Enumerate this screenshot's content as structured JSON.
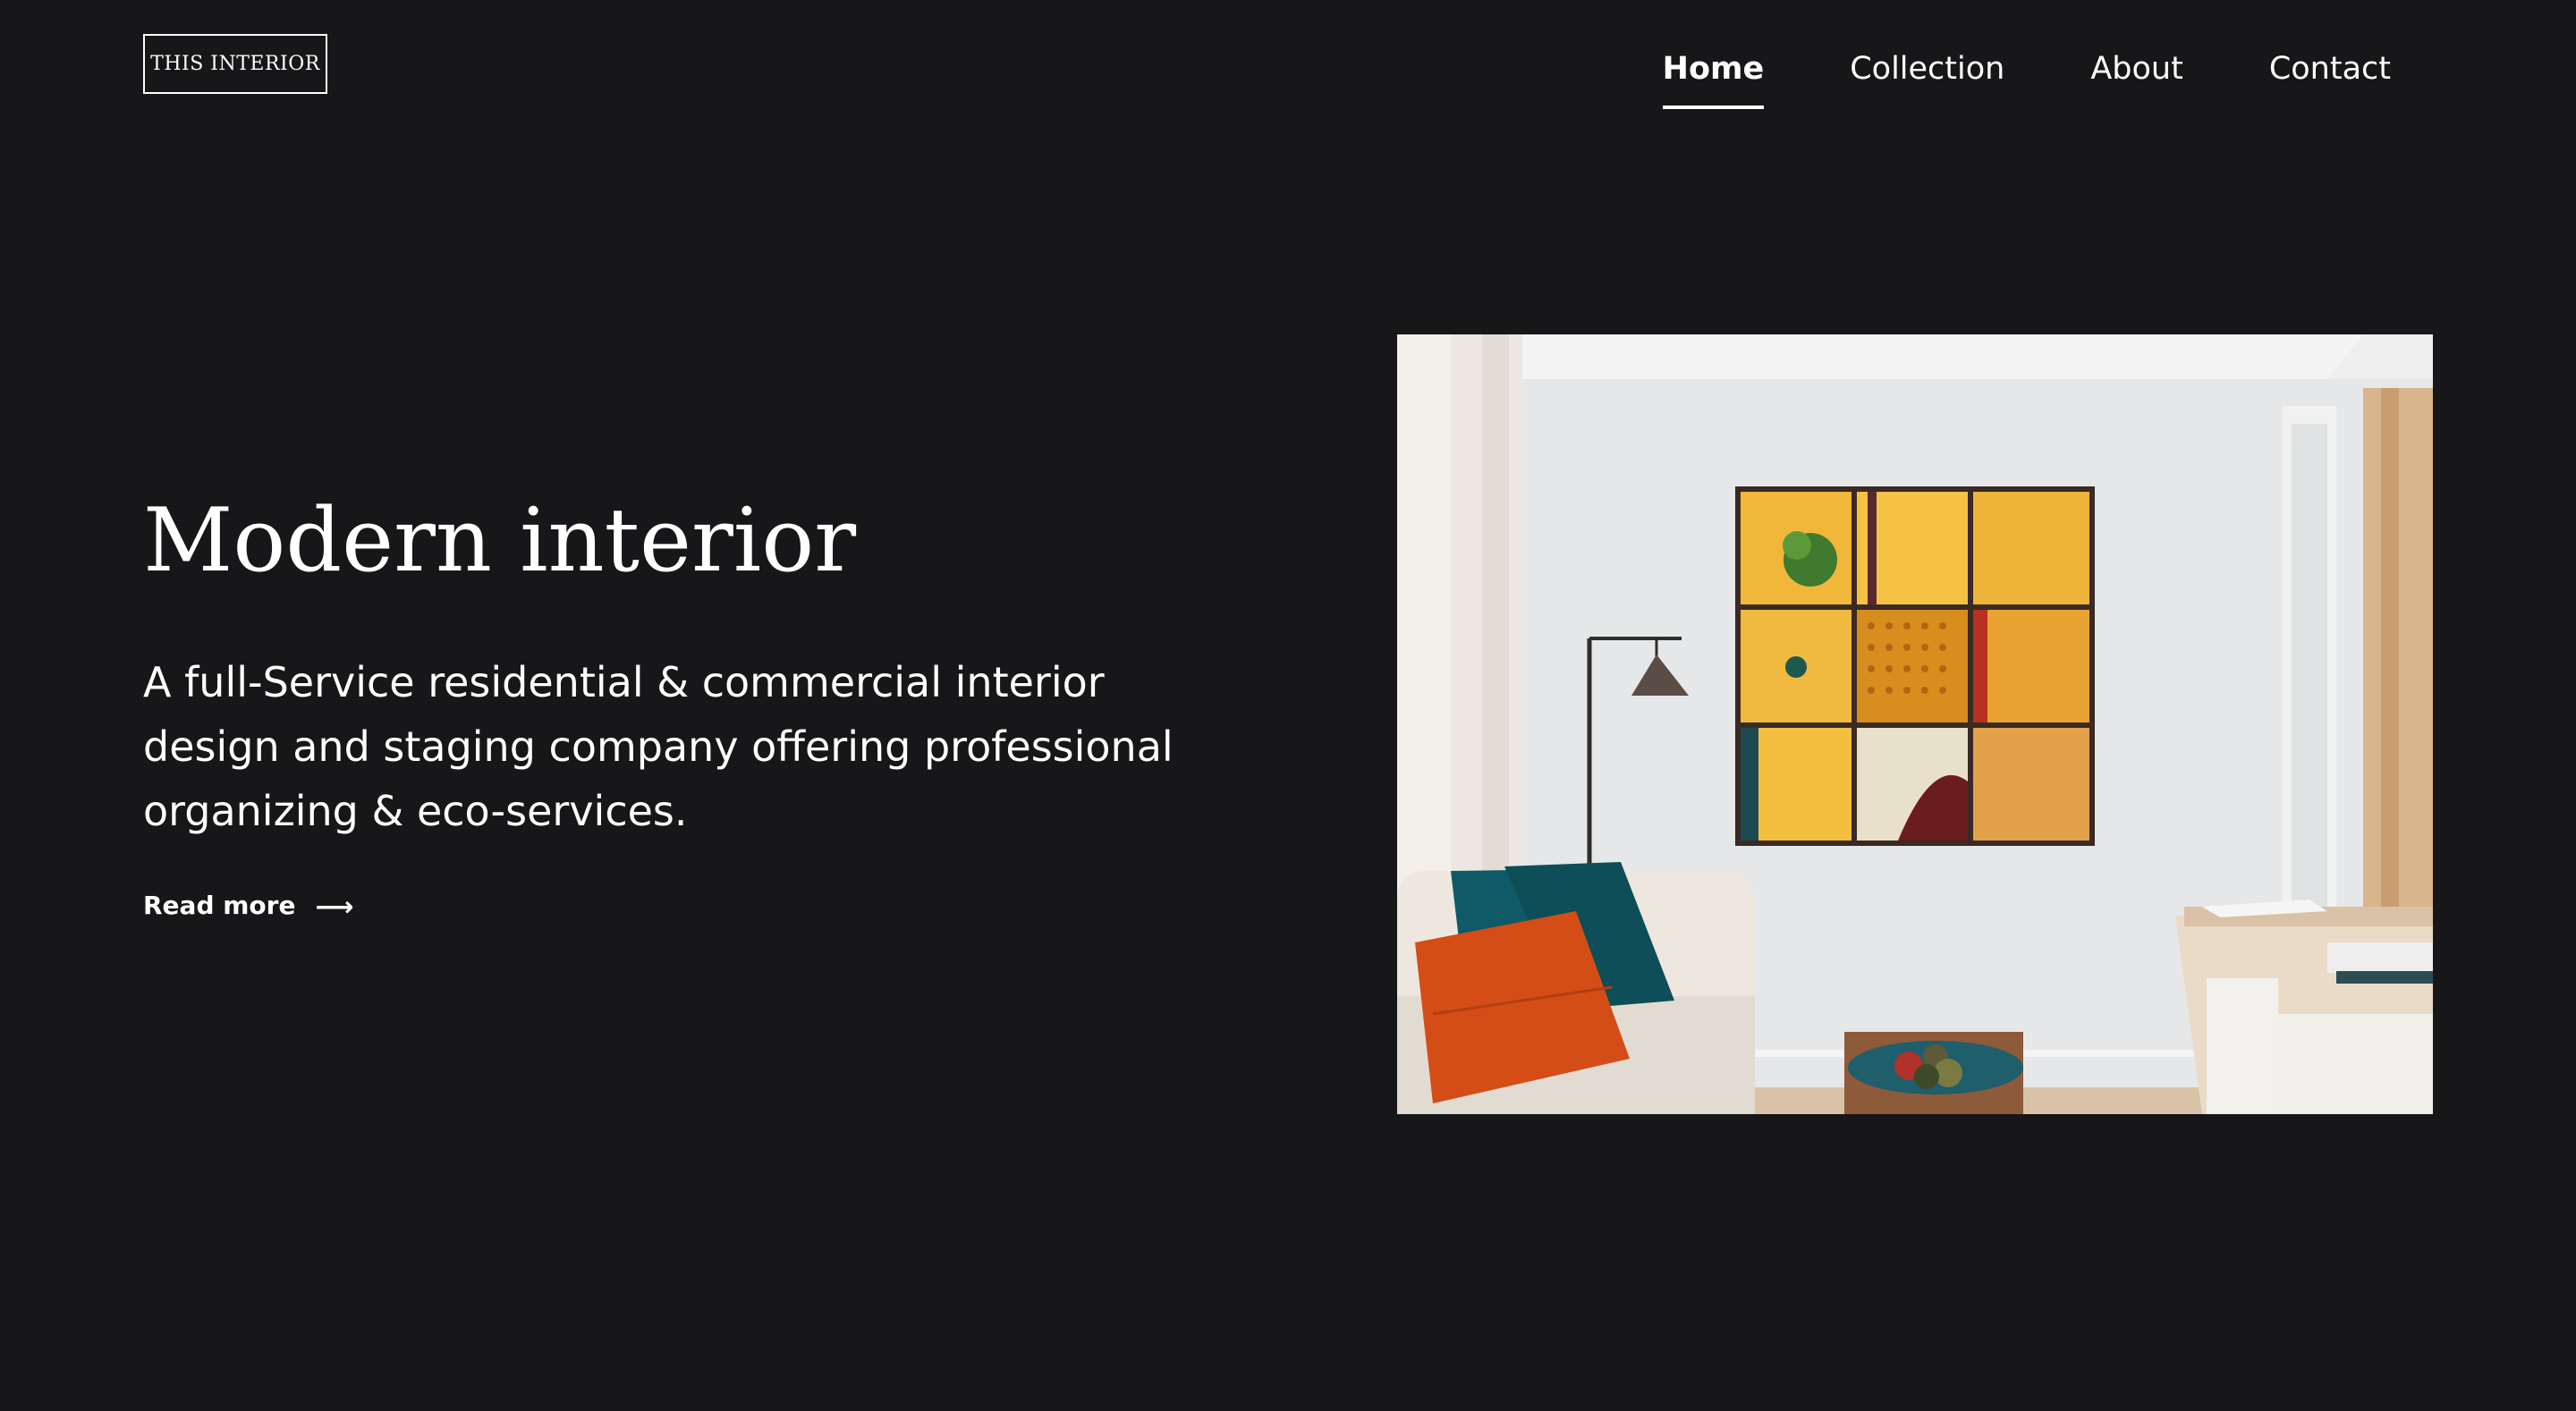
{
  "header": {
    "logo_text": "THIS INTERIOR",
    "nav": [
      {
        "label": "Home",
        "active": true
      },
      {
        "label": "Collection",
        "active": false
      },
      {
        "label": "About",
        "active": false
      },
      {
        "label": "Contact",
        "active": false
      }
    ]
  },
  "hero": {
    "title": "Modern interior",
    "description": "A full-Service residential & commercial interior design and staging company offering professional organizing & eco-services.",
    "cta_label": "Read more",
    "cta_icon": "arrow-right-icon"
  },
  "colors": {
    "background": "#171719",
    "text": "#ffffff",
    "accent_yellow": "#f2b93b",
    "accent_orange": "#d9501b",
    "accent_teal": "#0f5d66"
  }
}
